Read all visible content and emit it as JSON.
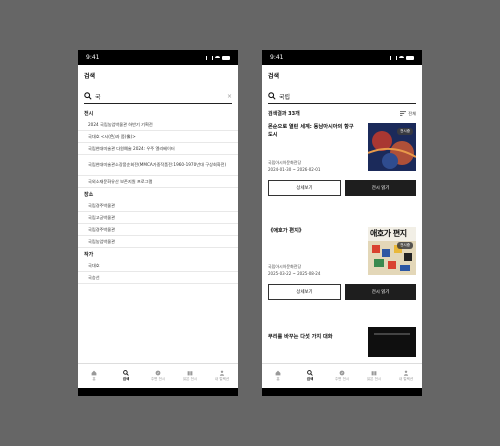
{
  "status": {
    "time": "9:41"
  },
  "left": {
    "header_title": "검색",
    "search_value": "국",
    "clear_symbol": "×",
    "sections": [
      {
        "label": "전시",
        "items": [
          "2024 국립농업박물관 하반기 기획전",
          "국대호 <시(色)과 쯤(像)>",
          "국립현대미술관 다원예술 2024: 우주 엘리베이터",
          "국립현대미술관소장품순회전(MMCA가중작품전:1960-1970년대 구상회화전)",
          "국외소재문화유산 보존지원 프로그램"
        ]
      },
      {
        "label": "장소",
        "items": [
          "국립경주박물관",
          "국립고궁박물관",
          "국립경주박물관",
          "국립농업박물관"
        ]
      },
      {
        "label": "작가",
        "items": [
          "국대호",
          "국승선"
        ]
      }
    ]
  },
  "right": {
    "header_title": "검색",
    "search_value": "국립",
    "result_count": "검색결과 33개",
    "sort_label": "전체",
    "cards": [
      {
        "title": "몬순으로 열린 세계: 동남아시아의 항구도시",
        "venue": "국립아시아문화전당",
        "dates": "2024-01-30 ~ 2026-02-01",
        "badge": "전시중",
        "btn_detail": "상세보기",
        "btn_review": "전시 읽기"
      },
      {
        "title": "《애호가 편지》",
        "venue": "국립아시아문화전당",
        "dates": "2025-03-22 ~ 2025-08-24",
        "badge": "전시중",
        "btn_detail": "상세보기",
        "btn_review": "전시 읽기",
        "poster_text": "애호가 편지"
      }
    ],
    "card3_title": "무리를 바꾸는 다섯 가지 대화"
  },
  "tabs": [
    {
      "label": "홈",
      "icon": "home-icon"
    },
    {
      "label": "검색",
      "icon": "search-icon",
      "active": true
    },
    {
      "label": "주변 전시",
      "icon": "compass-icon"
    },
    {
      "label": "읽은 전시",
      "icon": "book-icon"
    },
    {
      "label": "내 컬렉션",
      "icon": "person-icon"
    }
  ]
}
